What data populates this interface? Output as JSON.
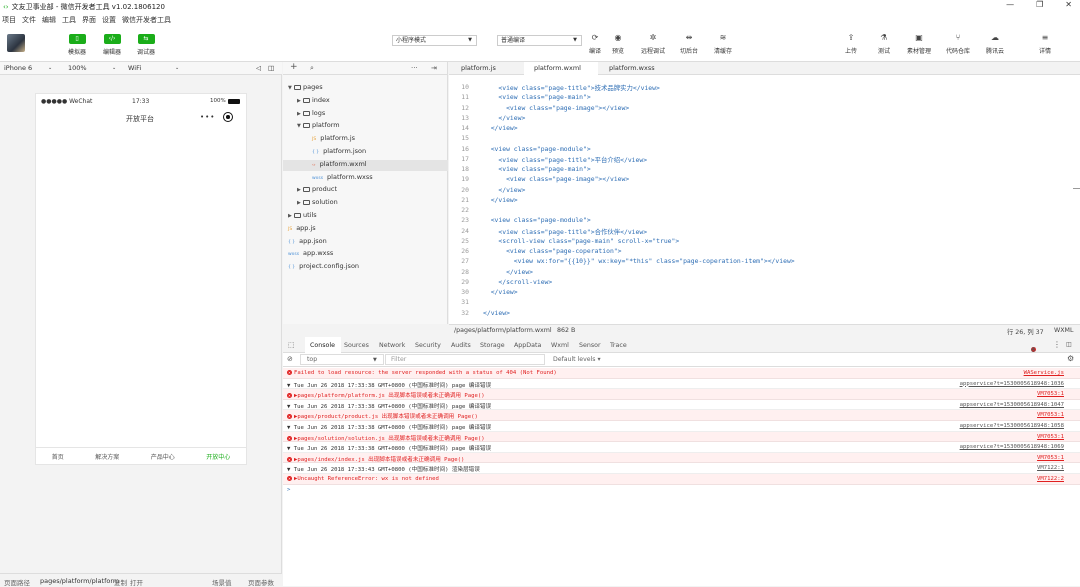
{
  "window": {
    "title": "文友卫事业部 - 微信开发者工具 v1.02.1806120",
    "controls": [
      "—",
      "❐",
      "✕"
    ]
  },
  "menu": [
    "项目",
    "文件",
    "编辑",
    "工具",
    "界面",
    "设置",
    "微信开发者工具"
  ],
  "toolbar": {
    "left_buttons": [
      {
        "label": "模拟器",
        "icon": "phone-icon"
      },
      {
        "label": "编辑器",
        "icon": "code-icon"
      },
      {
        "label": "调试器",
        "icon": "debug-icon"
      }
    ],
    "mode_select": "小程序模式",
    "compile_select": "普通编译",
    "center_buttons": [
      {
        "label": "编译",
        "icon": "refresh-icon",
        "glyph": "⟳"
      },
      {
        "label": "预览",
        "icon": "eye-icon",
        "glyph": "◉"
      },
      {
        "label": "远程调试",
        "icon": "bug-icon",
        "glyph": "✲"
      },
      {
        "label": "切后台",
        "icon": "split-icon",
        "glyph": "⇹"
      },
      {
        "label": "清缓存",
        "icon": "layers-icon",
        "glyph": "≋"
      }
    ],
    "right_buttons": [
      {
        "label": "上传",
        "icon": "upload-icon",
        "glyph": "⇪"
      },
      {
        "label": "测试",
        "icon": "flask-icon",
        "glyph": "⚗"
      },
      {
        "label": "素材管理",
        "icon": "image-icon",
        "glyph": "▣"
      },
      {
        "label": "代码仓库",
        "icon": "branch-icon",
        "glyph": "⑂"
      },
      {
        "label": "腾讯云",
        "icon": "cloud-icon",
        "glyph": "☁"
      },
      {
        "label": "详情",
        "icon": "menu-icon",
        "glyph": "≡"
      }
    ]
  },
  "device_bar": {
    "device": "iPhone 6",
    "zoom": "100%",
    "network": "WiFi"
  },
  "simulator": {
    "carrier": "●●●●● WeChat",
    "time": "17:33",
    "battery": "100%",
    "nav_title": "开放平台",
    "tabs": [
      "首页",
      "解决方案",
      "产品中心",
      "开放中心"
    ],
    "active_tab_color": "#1aad19"
  },
  "sim_footer": {
    "path_label": "页面路径",
    "path": "pages/platform/platform",
    "copy": "复制",
    "open": "打开",
    "scene": "场景值",
    "params": "页面参数"
  },
  "file_tree": [
    {
      "label": "pages",
      "type": "folder",
      "open": true,
      "depth": 0
    },
    {
      "label": "index",
      "type": "folder",
      "open": false,
      "depth": 1
    },
    {
      "label": "logs",
      "type": "folder",
      "open": false,
      "depth": 1
    },
    {
      "label": "platform",
      "type": "folder",
      "open": true,
      "depth": 1
    },
    {
      "label": "platform.js",
      "type": "js",
      "depth": 2
    },
    {
      "label": "platform.json",
      "type": "json",
      "depth": 2
    },
    {
      "label": "platform.wxml",
      "type": "wxml",
      "depth": 2,
      "selected": true
    },
    {
      "label": "platform.wxss",
      "type": "wxss",
      "depth": 2
    },
    {
      "label": "product",
      "type": "folder",
      "open": false,
      "depth": 1
    },
    {
      "label": "solution",
      "type": "folder",
      "open": false,
      "depth": 1
    },
    {
      "label": "utils",
      "type": "folder",
      "open": false,
      "depth": 0
    },
    {
      "label": "app.js",
      "type": "js",
      "depth": 0
    },
    {
      "label": "app.json",
      "type": "json",
      "depth": 0
    },
    {
      "label": "app.wxss",
      "type": "wxss",
      "depth": 0
    },
    {
      "label": "project.config.json",
      "type": "json",
      "depth": 0
    }
  ],
  "editor": {
    "tabs": [
      "platform.js",
      "platform.wxml",
      "platform.wxss"
    ],
    "active_tab": "platform.wxml",
    "lines": [
      {
        "n": "10",
        "code": "    <view class=\"page-title\">技术品牌实力</view>"
      },
      {
        "n": "11",
        "code": "    <view class=\"page-main\">"
      },
      {
        "n": "12",
        "code": "      <view class=\"page-image\"></view>"
      },
      {
        "n": "13",
        "code": "    </view>"
      },
      {
        "n": "14",
        "code": "  </view>"
      },
      {
        "n": "15",
        "code": ""
      },
      {
        "n": "16",
        "code": "  <view class=\"page-module\">"
      },
      {
        "n": "17",
        "code": "    <view class=\"page-title\">平台介绍</view>"
      },
      {
        "n": "18",
        "code": "    <view class=\"page-main\">"
      },
      {
        "n": "19",
        "code": "      <view class=\"page-image\"></view>"
      },
      {
        "n": "20",
        "code": "    </view>"
      },
      {
        "n": "21",
        "code": "  </view>"
      },
      {
        "n": "22",
        "code": ""
      },
      {
        "n": "23",
        "code": "  <view class=\"page-module\">"
      },
      {
        "n": "24",
        "code": "    <view class=\"page-title\">合作伙伴</view>"
      },
      {
        "n": "25",
        "code": "    <scroll-view class=\"page-main\" scroll-x=\"true\">"
      },
      {
        "n": "26",
        "code": "      <view class=\"page-coperation\">"
      },
      {
        "n": "27",
        "code": "        <view wx:for=\"{{10}}\" wx:key=\"*this\" class=\"page-coperation-item\"></view>"
      },
      {
        "n": "28",
        "code": "      </view>"
      },
      {
        "n": "29",
        "code": "    </scroll-view>"
      },
      {
        "n": "30",
        "code": "  </view>"
      },
      {
        "n": "31",
        "code": ""
      },
      {
        "n": "32",
        "code": "</view>"
      }
    ],
    "status": {
      "path": "/pages/platform/platform.wxml",
      "size": "862 B",
      "cursor": "行 26, 列 37",
      "lang": "WXML"
    }
  },
  "console": {
    "tabs": [
      "Console",
      "Sources",
      "Network",
      "Security",
      "Audits",
      "Storage",
      "AppData",
      "Wxml",
      "Sensor",
      "Trace"
    ],
    "active_tab": "Console",
    "context": "top",
    "filter_placeholder": "Filter",
    "levels": "Default levels ▾",
    "error_count": "6",
    "rows": [
      {
        "kind": "err",
        "text": "Failed to load resource: the server responded with a status of 404 (Not Found)",
        "src": "WAService.js"
      },
      {
        "kind": "info",
        "text": "▼ Tue Jun 26 2018 17:33:38 GMT+0800 (中国标准时间) page 编译错误",
        "src": "appservice?t=1530005618948:1036"
      },
      {
        "kind": "err",
        "text": "▶pages/platform/platform.js 出现脚本错误或者未正确调用 Page()",
        "src": "VM7053:1"
      },
      {
        "kind": "info",
        "text": "▼ Tue Jun 26 2018 17:33:38 GMT+0800 (中国标准时间) page 编译错误",
        "src": "appservice?t=1530005618948:1047"
      },
      {
        "kind": "err",
        "text": "▶pages/product/product.js 出现脚本错误或者未正确调用 Page()",
        "src": "VM7053:1"
      },
      {
        "kind": "info",
        "text": "▼ Tue Jun 26 2018 17:33:38 GMT+0800 (中国标准时间) page 编译错误",
        "src": "appservice?t=1530005618948:1058"
      },
      {
        "kind": "err",
        "text": "▶pages/solution/solution.js 出现脚本错误或者未正确调用 Page()",
        "src": "VM7053:1"
      },
      {
        "kind": "info",
        "text": "▼ Tue Jun 26 2018 17:33:38 GMT+0800 (中国标准时间) page 编译错误",
        "src": "appservice?t=1530005618948:1069"
      },
      {
        "kind": "err",
        "text": "▶pages/index/index.js 出现脚本错误或者未正确调用 Page()",
        "src": "VM7053:1"
      },
      {
        "kind": "info",
        "text": "▼ Tue Jun 26 2018 17:33:43 GMT+0800 (中国标准时间) 渲染层错误",
        "src": "VM7122:1"
      },
      {
        "kind": "err",
        "text": "▶Uncaught ReferenceError: wx is not defined",
        "src": "VM7122:2"
      }
    ],
    "prompt": ">"
  },
  "colors": {
    "accent": "#1aad19",
    "error": "#e02020"
  }
}
